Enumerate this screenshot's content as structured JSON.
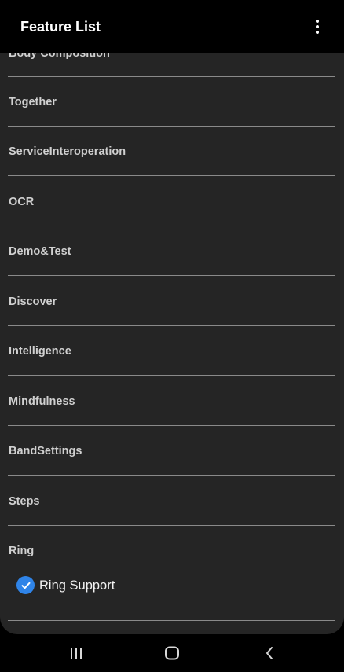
{
  "appbar": {
    "title": "Feature List",
    "menu_icon": "more-vertical-icon"
  },
  "list": {
    "partial_top_item": "Body Composition",
    "items": [
      "Together",
      "ServiceInteroperation",
      "OCR",
      "Demo&Test",
      "Discover",
      "Intelligence",
      "Mindfulness",
      "BandSettings",
      "Steps",
      "Ring"
    ],
    "ring_option": {
      "label": "Ring Support",
      "checked": true,
      "check_color": "#2f84e8"
    }
  },
  "navbar": {
    "recents_icon": "recents-icon",
    "home_icon": "home-icon",
    "back_icon": "back-icon"
  }
}
